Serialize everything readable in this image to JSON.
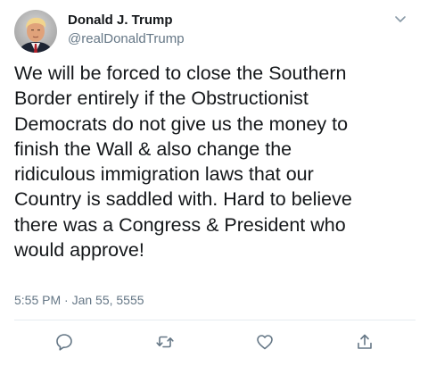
{
  "tweet": {
    "display_name": "Donald J. Trump",
    "handle": "@realDonaldTrump",
    "text": "We will be forced to close the Southern\nBorder entirely if the Obstructionist\nDemocrats do not give us the money to\nfinish the Wall & also change the\nridiculous immigration laws that our\nCountry is saddled with. Hard to believe\nthere was a Congress & President who\nwould approve!",
    "timestamp": "5:55 PM · Jan 55, 5555"
  },
  "icons": {
    "menu": "chevron-down-icon",
    "reply": "reply-icon",
    "retweet": "retweet-icon",
    "like": "like-icon",
    "share": "share-icon"
  },
  "colors": {
    "text": "#14171a",
    "secondary": "#657786",
    "divider": "#e6ecf0"
  }
}
